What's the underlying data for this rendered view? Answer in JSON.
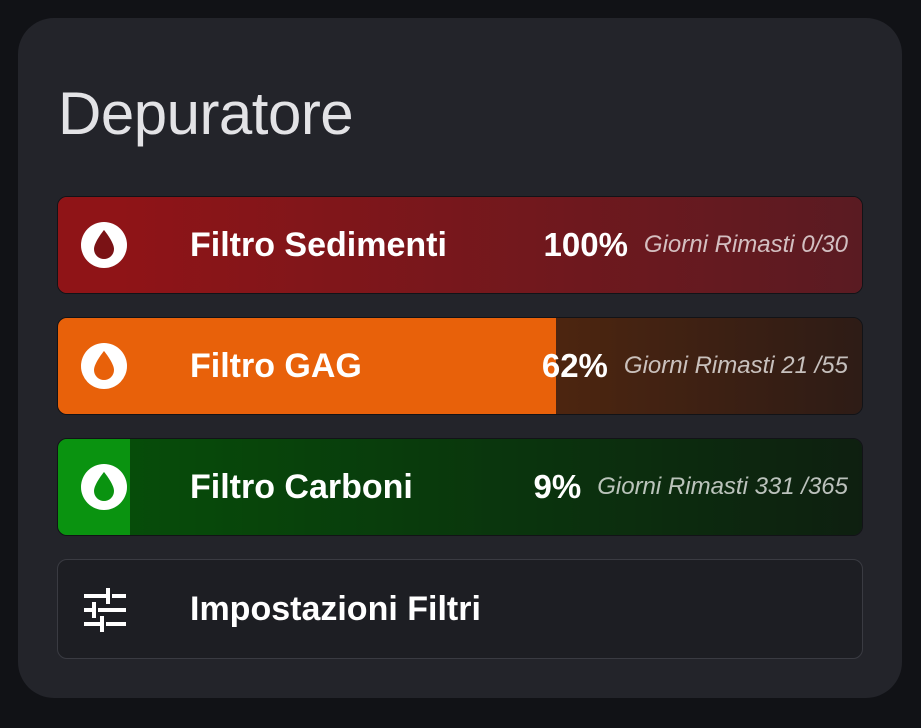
{
  "card": {
    "title": "Depuratore"
  },
  "filters": [
    {
      "name": "Filtro Sedimenti",
      "percent_text": "100%",
      "percent_value": 100,
      "days_text": "Giorni Rimasti 0/30",
      "icon": "water-drop-icon",
      "base_color": "#5a1b22",
      "fill_color": "#8f1417"
    },
    {
      "name": "Filtro GAG",
      "percent_text": "62%",
      "percent_value": 62,
      "days_text": "Giorni Rimasti 21 /55",
      "icon": "water-drop-icon",
      "base_color": "#533228",
      "fill_color": "#e8610a"
    },
    {
      "name": "Filtro Carboni",
      "percent_text": "9%",
      "percent_value": 9,
      "days_text": "Giorni Rimasti 331 /365",
      "icon": "water-drop-icon",
      "base_color": "#19391d",
      "fill_color": "#0a9310"
    }
  ],
  "settings": {
    "label": "Impostazioni Filtri",
    "icon": "sliders-icon"
  },
  "colors": {
    "page_background": "#111216",
    "card_background": "#23242a",
    "text_primary": "#ffffff",
    "title_text": "#e3e3e6"
  }
}
